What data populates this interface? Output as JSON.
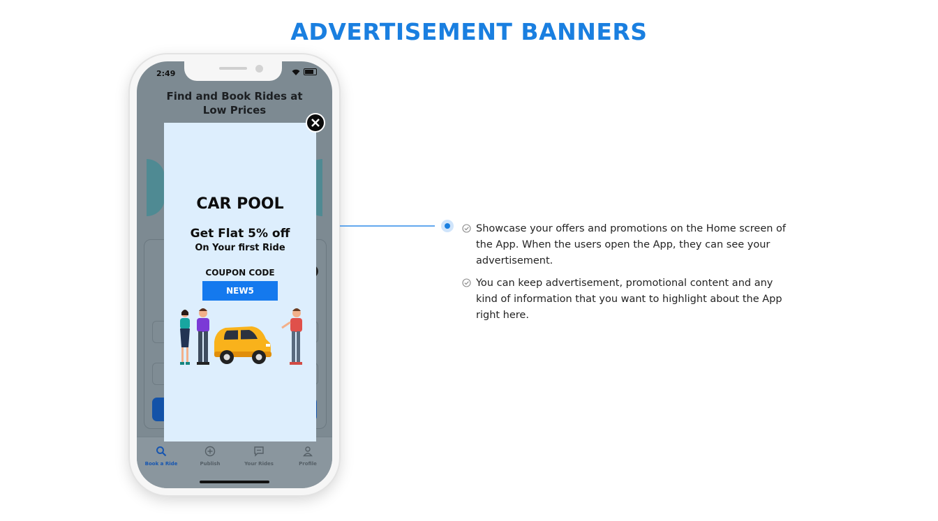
{
  "page": {
    "title": "ADVERTISEMENT BANNERS"
  },
  "phone": {
    "status_time": "2:49",
    "app_heading_line1": "Find and Book Rides at",
    "app_heading_line2": "Low Prices",
    "bottom_nav": [
      {
        "label": "Book a Ride",
        "icon": "search-icon",
        "active": true
      },
      {
        "label": "Publish",
        "icon": "plus-circle-icon",
        "active": false
      },
      {
        "label": "Your Rides",
        "icon": "chat-icon",
        "active": false
      },
      {
        "label": "Profile",
        "icon": "profile-icon",
        "active": false
      }
    ]
  },
  "popup": {
    "title": "CAR POOL",
    "offer": "Get Flat 5% off",
    "subtitle": "On Your first Ride",
    "coupon_label": "COUPON CODE",
    "coupon_code": "NEW5",
    "close_icon": "close-icon"
  },
  "features": [
    {
      "text": "Showcase your offers and promotions on the Home screen of the App. When the users open the App, they can see your advertisement."
    },
    {
      "text": "You can keep advertisement, promotional content and any kind of information that you want to highlight about the App right here."
    }
  ],
  "colors": {
    "accent": "#1a7fe0",
    "coupon_bg": "#1479ee",
    "popup_bg": "#ddeefd",
    "overlay": "#7d8a92"
  }
}
